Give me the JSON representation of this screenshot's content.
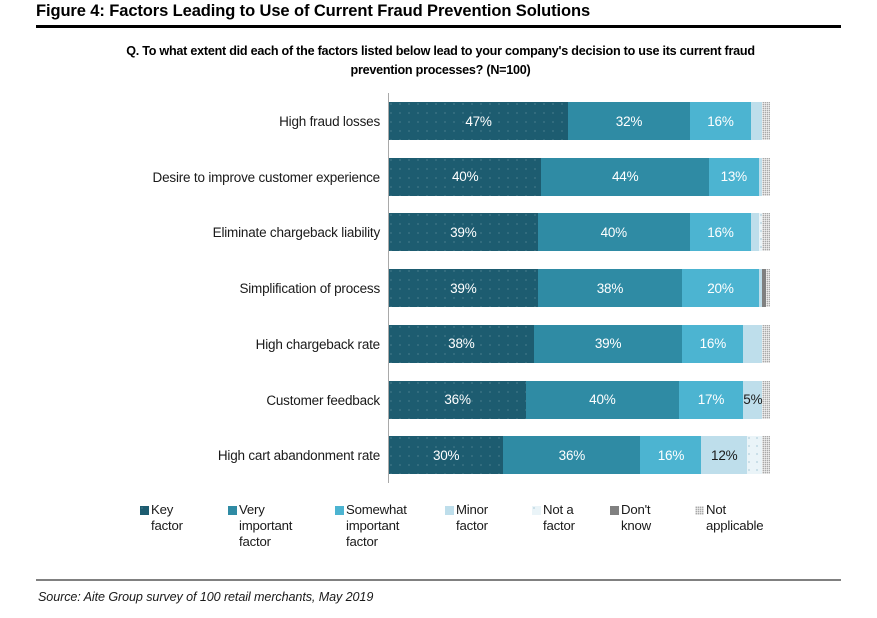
{
  "figure": {
    "title": "Figure 4: Factors Leading to Use of Current Fraud Prevention Solutions",
    "question": "Q. To what extent did each of the factors listed below lead to your company's decision to use its current fraud prevention processes? (N=100)",
    "source": "Source: Aite Group survey of 100 retail merchants, May 2019"
  },
  "colors": {
    "key_factor": "#1d5c70",
    "very_important_factor": "#2f8ba4",
    "somewhat_important_factor": "#4cb4d1",
    "minor_factor": "#bedeeb",
    "not_a_factor": "#eaf4f8",
    "dont_know": "#808080",
    "not_applicable": "#a9a9a9",
    "rule": "#000000",
    "axis": "#a9a9a9"
  },
  "legend": [
    {
      "label": "Key\nfactor",
      "color": "#1d5c70"
    },
    {
      "label": "Very\nimportant\nfactor",
      "color": "#2f8ba4"
    },
    {
      "label": "Somewhat\nimportant\nfactor",
      "color": "#4cb4d1"
    },
    {
      "label": "Minor\nfactor",
      "color": "#bedeeb"
    },
    {
      "label": "Not a\nfactor",
      "color": "#eaf4f8"
    },
    {
      "label": "Don't\nknow",
      "color": "#808080"
    },
    {
      "label": "Not\napplicable",
      "color": "#a9a9a9"
    }
  ],
  "chart_data": {
    "type": "bar",
    "orientation": "horizontal",
    "stacked": true,
    "normalized_percent": true,
    "title": "Figure 4: Factors Leading to Use of Current Fraud Prevention Solutions",
    "subtitle": "Q. To what extent did each of the factors listed below lead to your company's decision to use its current fraud prevention processes? (N=100)",
    "xlabel": "",
    "ylabel": "",
    "xlim": [
      0,
      100
    ],
    "grid": false,
    "legend_position": "bottom",
    "categories": [
      "High fraud losses",
      "Desire to improve customer experience",
      "Eliminate chargeback liability",
      "Simplification of process",
      "High chargeback rate",
      "Customer feedback",
      "High cart abandonment rate"
    ],
    "series": [
      {
        "name": "Key factor",
        "color": "#1d5c70",
        "values": [
          47,
          40,
          39,
          39,
          38,
          36,
          30
        ]
      },
      {
        "name": "Very important factor",
        "color": "#2f8ba4",
        "values": [
          32,
          44,
          40,
          38,
          39,
          40,
          36
        ]
      },
      {
        "name": "Somewhat important factor",
        "color": "#4cb4d1",
        "values": [
          16,
          13,
          16,
          20,
          16,
          17,
          16
        ]
      },
      {
        "name": "Minor factor",
        "color": "#bedeeb",
        "values": [
          3,
          1,
          2,
          1,
          5,
          5,
          12
        ]
      },
      {
        "name": "Not a factor",
        "color": "#eaf4f8",
        "values": [
          0,
          0,
          1,
          0,
          0,
          0,
          4
        ]
      },
      {
        "name": "Don't know",
        "color": "#808080",
        "values": [
          0,
          0,
          0,
          1,
          0,
          0,
          0
        ]
      },
      {
        "name": "Not applicable",
        "color": "#a9a9a9",
        "values": [
          2,
          2,
          2,
          1,
          2,
          2,
          2
        ]
      }
    ],
    "bar_labels": [
      [
        "47%",
        "32%",
        "16%",
        "",
        "",
        "",
        ""
      ],
      [
        "40%",
        "44%",
        "13%",
        "",
        "",
        "",
        ""
      ],
      [
        "39%",
        "40%",
        "16%",
        "",
        "",
        "",
        ""
      ],
      [
        "39%",
        "38%",
        "20%",
        "",
        "",
        "",
        ""
      ],
      [
        "38%",
        "39%",
        "16%",
        "",
        "",
        "",
        ""
      ],
      [
        "36%",
        "40%",
        "17%",
        "5%",
        "",
        "",
        ""
      ],
      [
        "30%",
        "36%",
        "16%",
        "12%",
        "",
        "",
        ""
      ]
    ]
  }
}
